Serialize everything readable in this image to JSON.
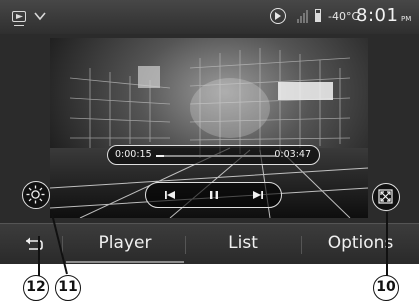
{
  "status_bar": {
    "temperature": "-40°C",
    "clock": "8:01",
    "ampm": "PM",
    "icons": [
      "source-menu-icon",
      "chevron-down-icon",
      "now-playing-icon",
      "signal-icon",
      "battery-icon"
    ]
  },
  "player": {
    "elapsed": "0:00:15",
    "total": "0:03:47",
    "progress": 0.07
  },
  "tabs": {
    "player": "Player",
    "list": "List",
    "options": "Options"
  },
  "callouts": {
    "back": "12",
    "brightness": "11",
    "fullscreen": "10"
  },
  "colors": {
    "screen_bg": "#2b2b2b",
    "text": "#f0f0f0",
    "outline": "#e0e0e0"
  }
}
